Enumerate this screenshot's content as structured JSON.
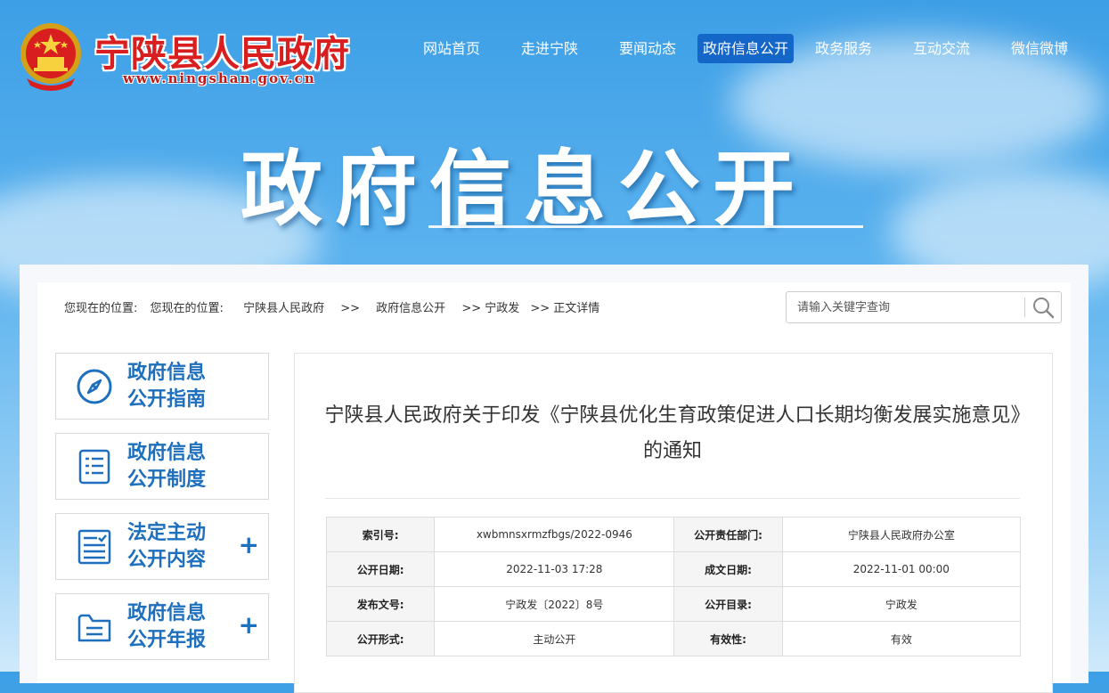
{
  "header": {
    "site_title": "宁陕县人民政府",
    "site_url": "www.ningshan.gov.cn",
    "emblem_icon": "national-emblem-icon"
  },
  "nav": {
    "items": [
      {
        "label": "网站首页"
      },
      {
        "label": "走进宁陕"
      },
      {
        "label": "要闻动态"
      },
      {
        "label": "政府信息公开"
      },
      {
        "label": "政务服务"
      },
      {
        "label": "互动交流"
      },
      {
        "label": "微信微博"
      }
    ],
    "active_index": 3
  },
  "banner": {
    "title": "政府信息公开"
  },
  "breadcrumb": {
    "prefix": "您现在的位置:",
    "label": "您现在的位置:",
    "items": [
      "宁陕县人民政府",
      ">>",
      "政府信息公开",
      ">> 宁政发",
      ">> 正文详情"
    ]
  },
  "search": {
    "placeholder": "请输入关键字查询",
    "icon": "search-icon"
  },
  "sidebar": {
    "items": [
      {
        "line1": "政府信息",
        "line2": "公开指南",
        "icon": "compass-icon",
        "expandable": false
      },
      {
        "line1": "政府信息",
        "line2": "公开制度",
        "icon": "document-list-icon",
        "expandable": false
      },
      {
        "line1": "法定主动",
        "line2": "公开内容",
        "icon": "checklist-icon",
        "expandable": true
      },
      {
        "line1": "政府信息",
        "line2": "公开年报",
        "icon": "folder-icon",
        "expandable": true
      }
    ],
    "plus": "+"
  },
  "article": {
    "title": "宁陕县人民政府关于印发《宁陕县优化生育政策促进人口长期均衡发展实施意见》的通知",
    "meta": [
      {
        "k1": "索引号:",
        "v1": "xwbmnsxrmzfbgs/2022-0946",
        "k2": "公开责任部门:",
        "v2": "宁陕县人民政府办公室"
      },
      {
        "k1": "公开日期:",
        "v1": "2022-11-03 17:28",
        "k2": "成文日期:",
        "v2": "2022-11-01 00:00"
      },
      {
        "k1": "发布文号:",
        "v1": "宁政发〔2022〕8号",
        "k2": "公开目录:",
        "v2": "宁政发"
      },
      {
        "k1": "公开形式:",
        "v1": "主动公开",
        "k2": "有效性:",
        "v2": "有效"
      }
    ]
  },
  "colors": {
    "accent": "#1e6fbd",
    "nav_active": "#1466c8",
    "title_red": "#d81e1e"
  }
}
